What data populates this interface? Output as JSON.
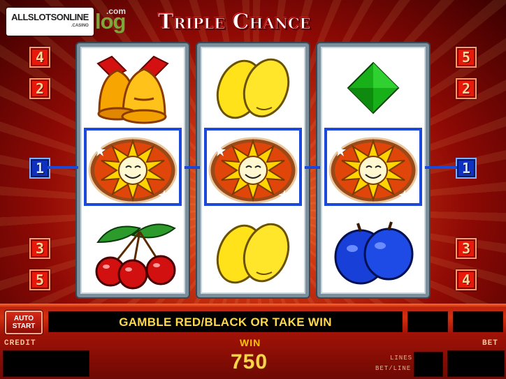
{
  "header": {
    "logo_text": "ALLSLOTSONLINE",
    "logo_sub": ".CASINO",
    "logo_blog": "log",
    "logo_dotcom": ".com",
    "title": "Triple Chance"
  },
  "line_markers": {
    "left": [
      "4",
      "2",
      "1",
      "3",
      "5"
    ],
    "right": [
      "5",
      "2",
      "1",
      "3",
      "4"
    ]
  },
  "reels": [
    {
      "top": "bell-icon",
      "middle": "sun-icon",
      "bottom": "cherry-icon"
    },
    {
      "top": "lemon-icon",
      "middle": "sun-icon",
      "bottom": "lemon-icon"
    },
    {
      "top": "diamond-icon",
      "middle": "sun-icon",
      "bottom": "plum-icon"
    }
  ],
  "panel": {
    "autostart_line1": "AUTO",
    "autostart_line2": "START",
    "message": "GAMBLE RED/BLACK OR TAKE WIN",
    "credit_label": "CREDIT",
    "bet_label": "BET",
    "win_label": "WIN",
    "win_value": "750",
    "lines_label": "LINES",
    "betline_label": "BET/LINE"
  },
  "colors": {
    "accent_red": "#e8180a",
    "payline_blue": "#1c49d8",
    "win_yellow": "#ffd34a"
  }
}
